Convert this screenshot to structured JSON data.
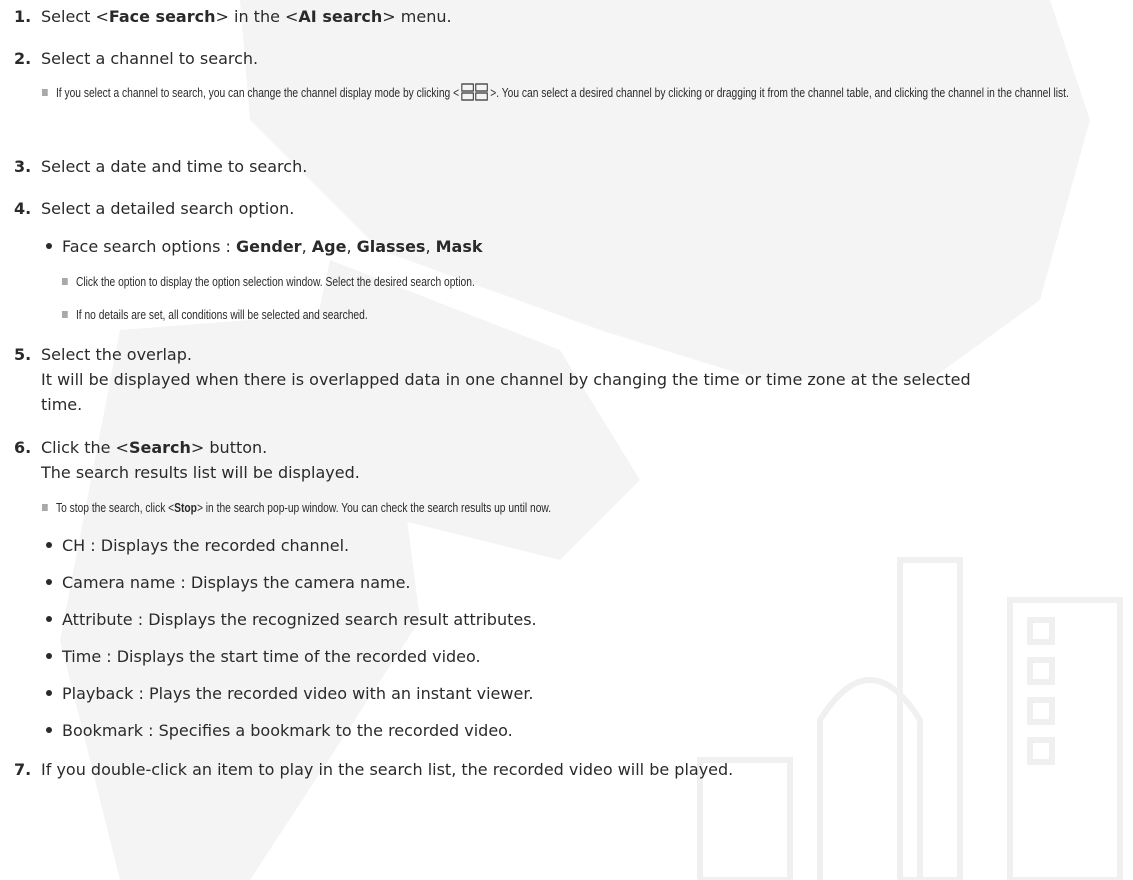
{
  "steps": [
    {
      "num": "1.",
      "p1": "Select <",
      "b1": "Face search",
      "p2": "> in the <",
      "b2": "AI search",
      "p3": "> menu."
    },
    {
      "num": "2.",
      "text": "Select a channel to search."
    },
    {
      "num": "3.",
      "text": "Select a date and time to search."
    },
    {
      "num": "4.",
      "text": "Select a detailed search option."
    },
    {
      "num": "5.",
      "text": "Select the overlap.",
      "cont1": "It will be displayed when there is overlapped data in one channel by changing the time or time zone at the selected",
      "cont2": "time."
    },
    {
      "num": "6.",
      "p1": "Click the <",
      "b1": "Search",
      "p2": "> button.",
      "cont1": "The search results list will be displayed."
    },
    {
      "num": "7.",
      "text": "If you double-click an item to play in the search list, the recorded video will be played."
    }
  ],
  "note_channel": {
    "p1": "If you select a channel to search, you can change the channel display mode by clicking <",
    "p2": ">. You can select a desired channel by clicking or dragging it from the channel table, and clicking the channel in the channel list."
  },
  "face_options": {
    "label": "Face search options : ",
    "o1": "Gender",
    "o2": "Age",
    "o3": "Glasses",
    "o4": "Mask",
    "sep": ", "
  },
  "notes_options": [
    "Click the option to display the option selection window. Select the desired search option.",
    "If no details are set, all conditions will be selected and searched."
  ],
  "note_stop": {
    "p1": "To stop the search, click <",
    "b1": "Stop",
    "p2": "> in the search pop-up window. You can check the search results up until now."
  },
  "result_fields": [
    "CH : Displays the recorded channel.",
    "Camera name : Displays the camera name.",
    "Attribute : Displays the recognized search result attributes.",
    "Time : Displays the start time of the recorded video.",
    "Playback : Plays the recorded video with an instant viewer.",
    "Bookmark : Specifies a bookmark to the recorded video."
  ],
  "colors": {
    "text": "#2a2a2a",
    "watermark": "#f3f3f3",
    "note_marker": "#a9a9a9"
  },
  "icons": {
    "channel_mode": "quad-grid-icon"
  }
}
